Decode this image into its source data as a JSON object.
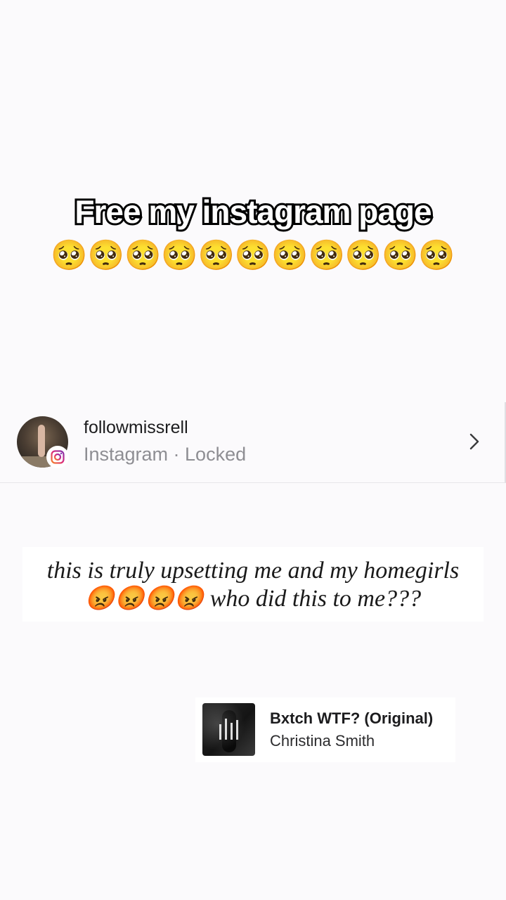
{
  "caption": {
    "title": "Free my instagram page",
    "emojis": "🥺🥺🥺🥺🥺🥺🥺🥺🥺🥺🥺"
  },
  "share_card": {
    "username": "followmissrell",
    "source": "Instagram · Locked",
    "avatar_icon": "profile-photo",
    "badge_icon": "instagram-icon",
    "chevron_icon": "chevron-right-icon"
  },
  "quote": {
    "line1": "this is truly upsetting me and my homegirls",
    "line2": "😡😡😡😡 who did this to me???"
  },
  "music": {
    "title": "Bxtch WTF? (Original)",
    "artist": "Christina Smith",
    "art_icon": "play-bars-icon"
  },
  "colors": {
    "background": "#fbfafc",
    "text_primary": "#1c1c1e",
    "text_secondary": "#8e8e93",
    "instagram_gradient_start": "#f58529",
    "instagram_gradient_end": "#8134af"
  }
}
